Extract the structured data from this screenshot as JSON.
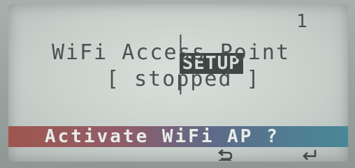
{
  "header": {
    "separator_left": "|",
    "badge": "SETUP",
    "separator_right": "|",
    "page_number": "1"
  },
  "main": {
    "title": "WiFi Access Point",
    "status": "[ stopped ]"
  },
  "action": {
    "label": "Activate WiFi AP ?"
  },
  "softkeys": {
    "back_icon": "undo-arrow-icon",
    "enter_icon": "enter-return-icon"
  },
  "colors": {
    "action_bar_left": "#a0564d",
    "action_bar_right": "#4a8796",
    "lcd_text": "#4a514f"
  }
}
